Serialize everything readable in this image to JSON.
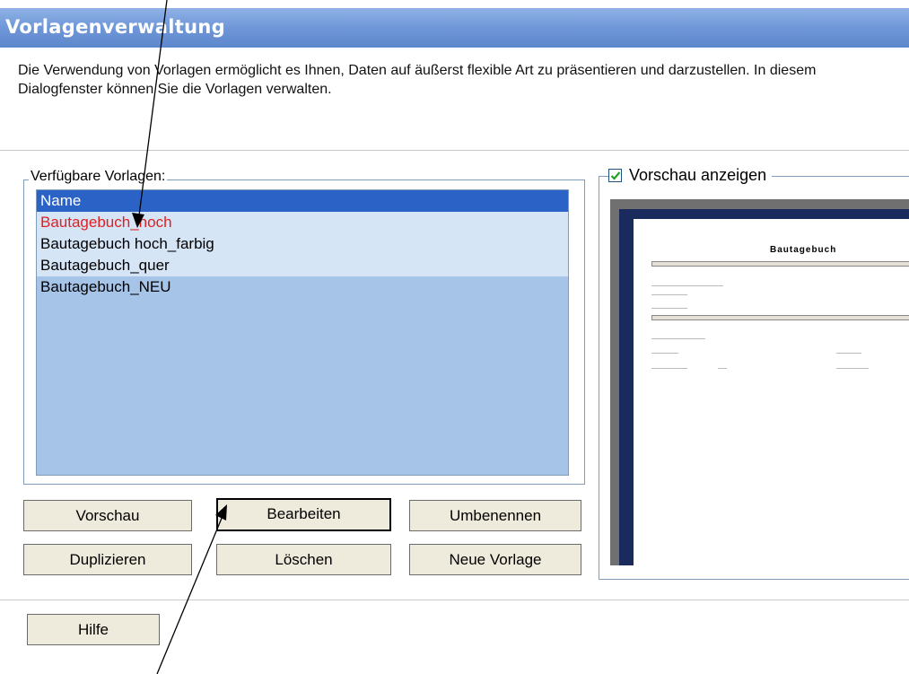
{
  "dialog": {
    "title": "Vorlagenverwaltung",
    "description": "Die Verwendung von Vorlagen ermöglicht es Ihnen, Daten auf äußerst flexible Art zu präsentieren und darzustellen. In diesem Dialogfenster können Sie die Vorlagen verwalten."
  },
  "templates": {
    "group_label": "Verfügbare Vorlagen:",
    "column_header": "Name",
    "items": [
      {
        "label": "Bautagebuch_hoch"
      },
      {
        "label": "Bautagebuch hoch_farbig"
      },
      {
        "label": "Bautagebuch_quer"
      },
      {
        "label": "Bautagebuch_NEU"
      }
    ],
    "selected_index": 0
  },
  "buttons": {
    "preview": "Vorschau",
    "edit": "Bearbeiten",
    "rename": "Umbenennen",
    "duplicate": "Duplizieren",
    "delete": "Löschen",
    "new_template": "Neue Vorlage",
    "help": "Hilfe"
  },
  "preview": {
    "checkbox_label": "Vorschau anzeigen",
    "checked": true,
    "page_title": "Bautagebuch"
  },
  "colors": {
    "title_bar": "#6f97d8",
    "list_header": "#2b62c6",
    "list_background": "#a6c3e8",
    "selected_text": "#e02020",
    "button_face": "#efebdc"
  }
}
